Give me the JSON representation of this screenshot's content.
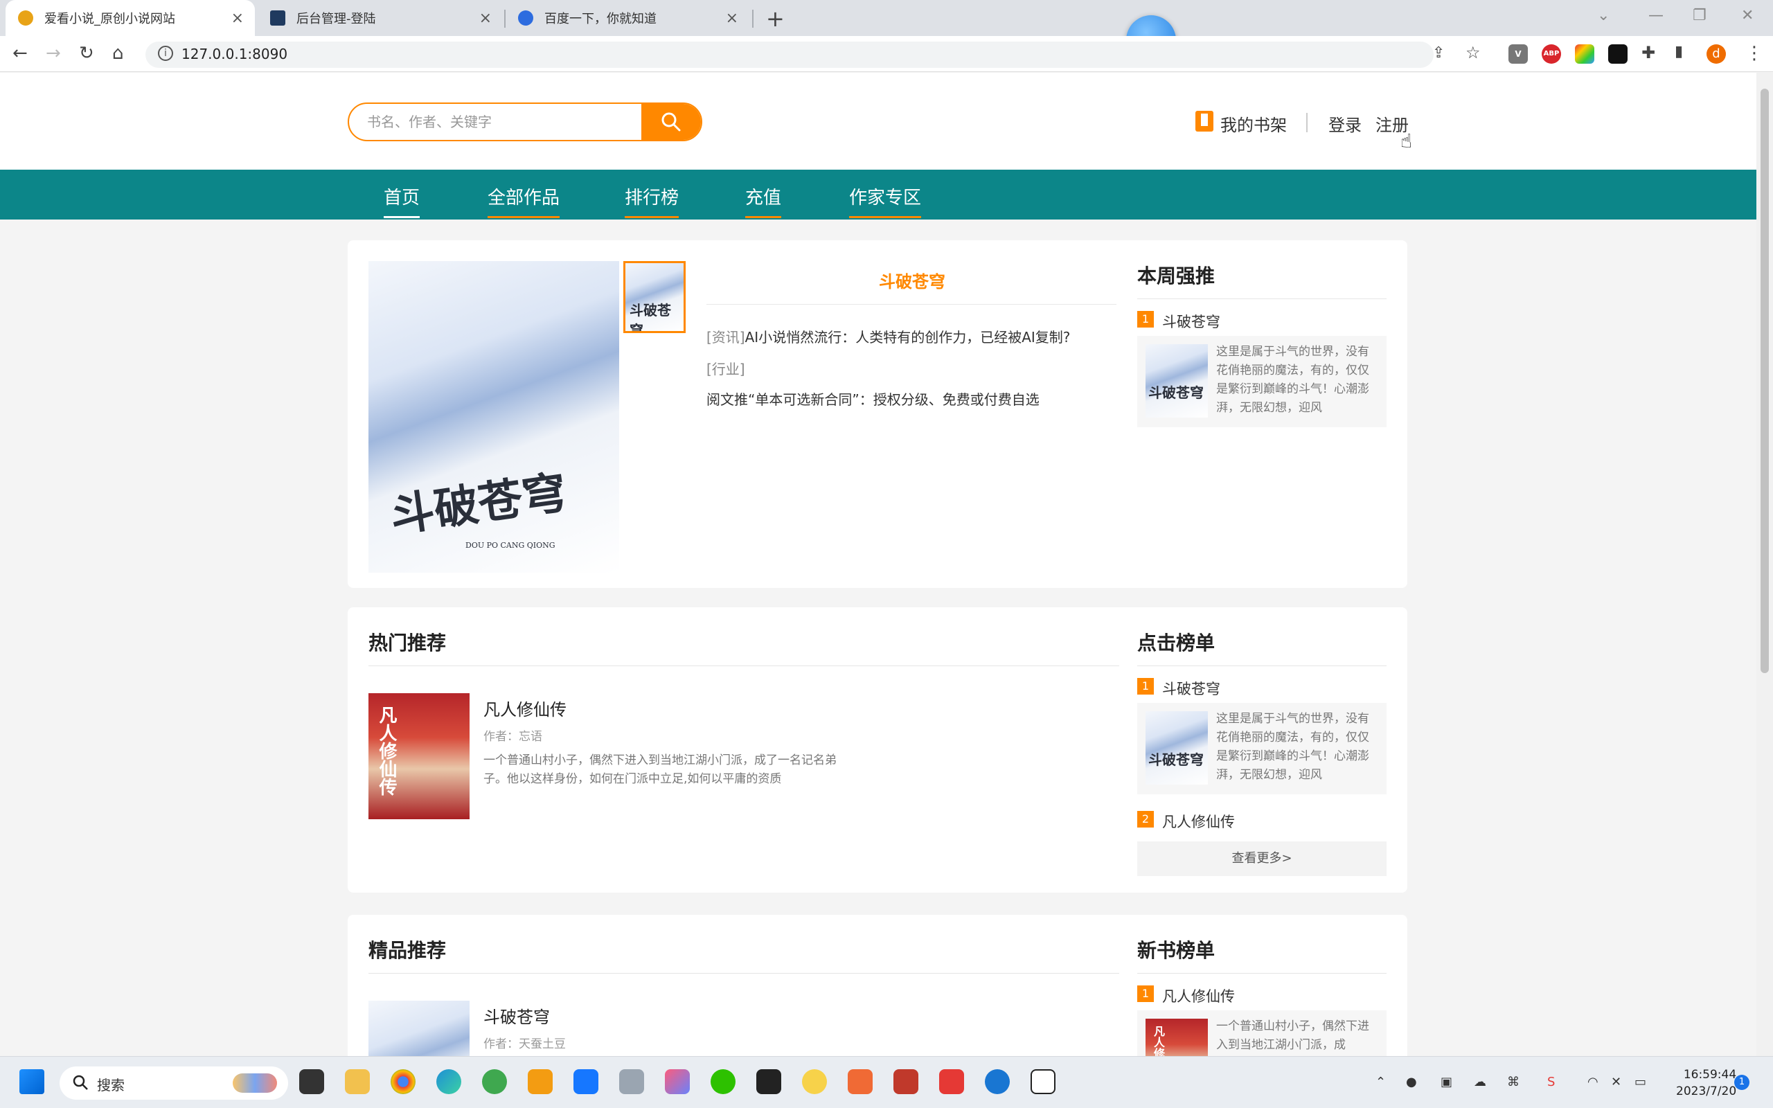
{
  "browser": {
    "tabs": [
      {
        "title": "爱看小说_原创小说网站",
        "active": true
      },
      {
        "title": "后台管理-登陆",
        "active": false
      },
      {
        "title": "百度一下，你就知道",
        "active": false
      }
    ],
    "url": "127.0.0.1:8090",
    "profile_initial": "d",
    "ext_abp": "ABP"
  },
  "header": {
    "search_placeholder": "书名、作者、关键字",
    "bookshelf": "我的书架",
    "login": "登录",
    "register": "注册"
  },
  "nav": [
    "首页",
    "全部作品",
    "排行榜",
    "充值",
    "作家专区"
  ],
  "featured": {
    "book_title": "斗破苍穹",
    "cover_text": "斗破苍穹",
    "cover_subtext": "DOU PO CANG QIONG",
    "news": [
      {
        "tag": "[资讯]",
        "text": "AI小说悄然流行：人类特有的创作力，已经被AI复制?"
      },
      {
        "tag": "[行业]",
        "text": ""
      },
      {
        "tag": "",
        "text": "阅文推“单本可选新合同”：授权分级、免费或付费自选"
      }
    ]
  },
  "weekly": {
    "title": "本周强推",
    "items": [
      {
        "rank": "1",
        "name": "斗破苍穹",
        "desc": "这里是属于斗气的世界，没有花俏艳丽的魔法，有的，仅仅是繁衍到巅峰的斗气！心潮澎湃，无限幻想，迎风"
      }
    ]
  },
  "hot": {
    "title": "热门推荐",
    "book": {
      "title": "凡人修仙传",
      "author": "作者：忘语",
      "desc": "一个普通山村小子，偶然下进入到当地江湖小门派，成了一名记名弟子。他以这样身份，如何在门派中立足,如何以平庸的资质",
      "cover_text": "凡人修仙传"
    }
  },
  "clicks": {
    "title": "点击榜单",
    "items": [
      {
        "rank": "1",
        "name": "斗破苍穹",
        "desc": "这里是属于斗气的世界，没有花俏艳丽的魔法，有的，仅仅是繁衍到巅峰的斗气！心潮澎湃，无限幻想，迎风"
      },
      {
        "rank": "2",
        "name": "凡人修仙传"
      }
    ],
    "more": "查看更多>"
  },
  "quality": {
    "title": "精品推荐",
    "book": {
      "title": "斗破苍穹",
      "author": "作者：天蚕土豆"
    }
  },
  "newbooks": {
    "title": "新书榜单",
    "items": [
      {
        "rank": "1",
        "name": "凡人修仙传",
        "desc": "一个普通山村小子，偶然下进入到当地江湖小门派，成"
      }
    ]
  },
  "taskbar": {
    "search_label": "搜索",
    "time": "16:59:44",
    "date": "2023/7/20",
    "notif_count": "1"
  },
  "colors": {
    "accent": "#ff8800",
    "nav": "#0c8689"
  }
}
